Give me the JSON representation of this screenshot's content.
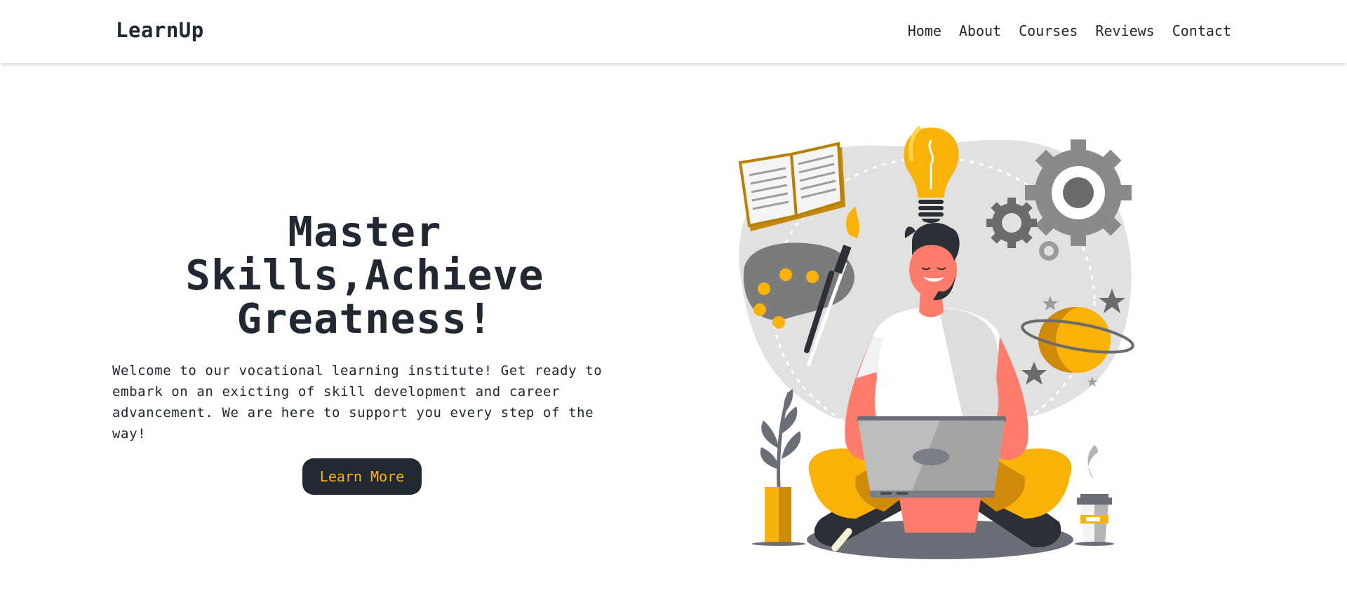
{
  "header": {
    "brand": "LearnUp",
    "nav": [
      {
        "label": "Home"
      },
      {
        "label": "About"
      },
      {
        "label": "Courses"
      },
      {
        "label": "Reviews"
      },
      {
        "label": "Contact"
      }
    ]
  },
  "hero": {
    "title_lines": [
      "Master",
      "Skills,Achieve",
      "Greatness!"
    ],
    "description": "Welcome to our vocational learning institute! Get ready to embark on an exicting of skill development and career advancement. We are here to support you every step of the way!",
    "cta_label": "Learn More"
  },
  "colors": {
    "dark": "#222831",
    "accent": "#f9b208",
    "coral": "#ff7b6b",
    "gray": "#8a8a8a",
    "blob": "#e1e1e1"
  },
  "illustration": {
    "subject": "person-with-laptop-illustration",
    "icons": [
      "book-icon",
      "lightbulb-icon",
      "gear-icon",
      "palette-icon",
      "planet-icon",
      "star-icon",
      "plant-icon",
      "coffee-cup-icon"
    ]
  }
}
